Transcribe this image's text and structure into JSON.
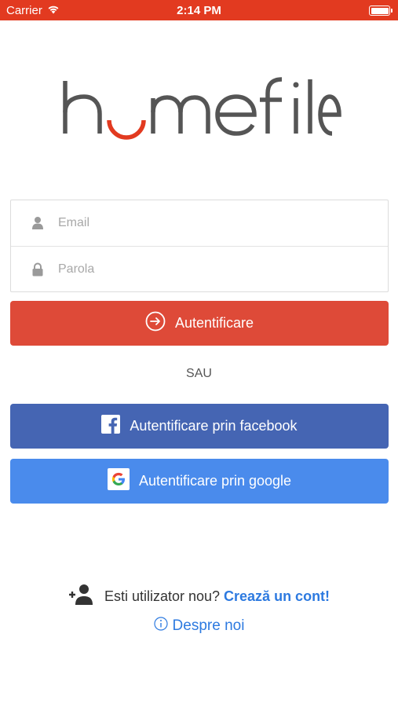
{
  "status_bar": {
    "carrier": "Carrier",
    "time": "2:14 PM"
  },
  "logo": {
    "text": "homefile",
    "icon": "homefile-logo",
    "accent_color": "#e23a20"
  },
  "form": {
    "email": {
      "placeholder": "Email",
      "value": "",
      "icon": "user-icon"
    },
    "password": {
      "placeholder": "Parola",
      "value": "",
      "icon": "lock-icon"
    }
  },
  "buttons": {
    "login": {
      "label": "Autentificare",
      "icon": "sign-in-icon",
      "color": "#de4a38"
    },
    "or_label": "SAU",
    "facebook": {
      "label": "Autentificare prin facebook",
      "icon": "facebook-icon",
      "color": "#4565b3"
    },
    "google": {
      "label": "Autentificare prin google",
      "icon": "google-icon",
      "color": "#4a8bec"
    }
  },
  "footer": {
    "register_prompt": "Esti utilizator nou?",
    "register_link": "Crează un cont!",
    "about_icon": "info-icon",
    "about_link": "Despre noi"
  }
}
